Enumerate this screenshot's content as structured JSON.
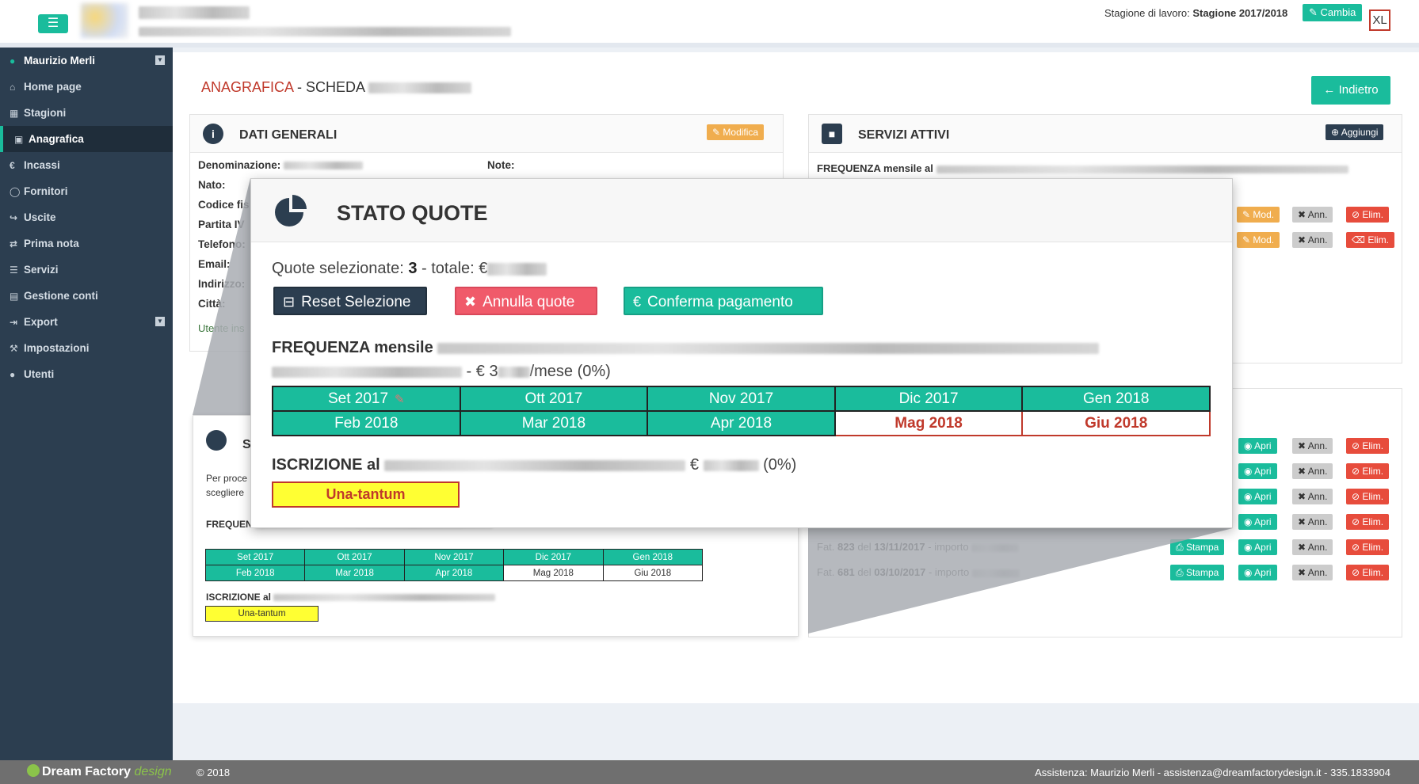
{
  "topbar": {
    "menu_icon": "hamburger-icon",
    "season_prefix": "Stagione di lavoro:",
    "season_value": "Stagione 2017/2018",
    "cambia_label": "Cambia",
    "xl_label": "XL"
  },
  "sidebar": {
    "user": "Maurizio Merli",
    "items": [
      {
        "label": "Home page",
        "icon": "home-icon"
      },
      {
        "label": "Stagioni",
        "icon": "calendar-icon"
      },
      {
        "label": "Anagrafica",
        "icon": "address-book-icon"
      },
      {
        "label": "Incassi",
        "icon": "euro-icon"
      },
      {
        "label": "Fornitori",
        "icon": "supplier-icon"
      },
      {
        "label": "Uscite",
        "icon": "sign-out-icon"
      },
      {
        "label": "Prima nota",
        "icon": "exchange-icon"
      },
      {
        "label": "Servizi",
        "icon": "list-icon"
      },
      {
        "label": "Gestione conti",
        "icon": "bank-icon"
      },
      {
        "label": "Export",
        "icon": "export-icon"
      },
      {
        "label": "Impostazioni",
        "icon": "wrench-icon"
      },
      {
        "label": "Utenti",
        "icon": "users-icon"
      }
    ]
  },
  "page": {
    "title_red": "ANAGRAFICA",
    "title_rest": " - SCHEDA ",
    "back_label": "Indietro"
  },
  "dati": {
    "title": "DATI GENERALI",
    "modifica": "Modifica",
    "fields": [
      "Denominazione:",
      "Nato:",
      "Codice fis",
      "Partita IV",
      "Telefono:",
      "Email:",
      "Indirizzo:",
      "Città:"
    ],
    "note": "Note:",
    "utente": "Utente ins"
  },
  "servizi": {
    "title": "SERVIZI ATTIVI",
    "aggiungi": "Aggiungi",
    "freq_prefix": "FREQUENZA mensile al",
    "mod": "Mod.",
    "ann": "Ann.",
    "elim": "Elim."
  },
  "fatture": {
    "apri": "Apri",
    "stampa": "Stampa",
    "rows": [
      {
        "pre": "Fat. ",
        "num": "823",
        "mid": " del ",
        "date": "13/11/2017",
        "post": " - importo "
      },
      {
        "pre": "Fat. ",
        "num": "681",
        "mid": " del ",
        "date": "03/10/2017",
        "post": " - importo "
      }
    ]
  },
  "small_stato": {
    "title": "S",
    "text1": "Per proce",
    "text2": "scegliere",
    "freq": "FREQUEN",
    "iscr": "ISCRIZIONE al",
    "una": "Una-tantum",
    "months": [
      [
        "Set 2017",
        "Ott 2017",
        "Nov 2017",
        "Dic 2017",
        "Gen 2018"
      ],
      [
        "Feb 2018",
        "Mar 2018",
        "Apr 2018",
        "Mag 2018",
        "Giu 2018"
      ]
    ]
  },
  "modal": {
    "title": "STATO QUOTE",
    "quote_prefix": "Quote selezionate: ",
    "quote_count": "3",
    "quote_mid": " - totale: €",
    "reset": "Reset Selezione",
    "annulla": "Annulla quote",
    "conferma": "Conferma pagamento",
    "freq_bold": "FREQUENZA mensile",
    "freq_tail": " - € 3",
    "freq_tail2": "/mese (0%)",
    "iscr_bold": "ISCRIZIONE al",
    "iscr_tail": " € ",
    "iscr_pct": " (0%)",
    "una": "Una-tantum",
    "months": [
      [
        "Set 2017",
        "Ott 2017",
        "Nov 2017",
        "Dic 2017",
        "Gen 2018"
      ],
      [
        "Feb 2018",
        "Mar 2018",
        "Apr 2018",
        "Mag 2018",
        "Giu 2018"
      ]
    ]
  },
  "footer": {
    "brand": "Dream Factory",
    "brand_design": "design",
    "copy": "© 2018",
    "assist": "Assistenza: Maurizio Merli - assistenza@dreamfactorydesign.it - 335.1833904"
  }
}
